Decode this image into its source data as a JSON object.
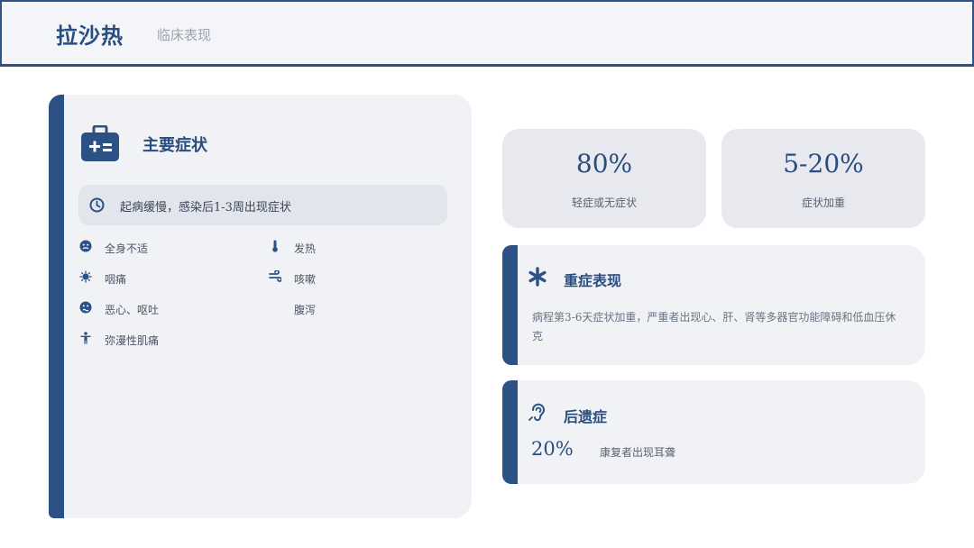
{
  "header": {
    "title": "拉沙热",
    "subtitle": "临床表现"
  },
  "main_card": {
    "title": "主要症状",
    "onset": "起病缓慢，感染后1-3周出现症状",
    "symptoms": [
      {
        "label": "全身不适",
        "icon": "sick-face-icon"
      },
      {
        "label": "发热",
        "icon": "thermometer-icon"
      },
      {
        "label": "咽痛",
        "icon": "virus-icon"
      },
      {
        "label": "咳嗽",
        "icon": "cough-icon"
      },
      {
        "label": "恶心、呕吐",
        "icon": "nausea-face-icon"
      },
      {
        "label": "腹泻",
        "icon": ""
      },
      {
        "label": "弥漫性肌痛",
        "icon": "person-icon"
      }
    ]
  },
  "stats": [
    {
      "value": "80%",
      "caption": "轻症或无症状"
    },
    {
      "value": "5-20%",
      "caption": "症状加重"
    }
  ],
  "severe": {
    "title": "重症表现",
    "icon": "asterisk-icon",
    "description": "病程第3-6天症状加重，严重者出现心、肝、肾等多器官功能障碍和低血压休克"
  },
  "sequelae": {
    "title": "后遗症",
    "icon": "ear-icon",
    "value": "20%",
    "description": "康复者出现耳聋"
  },
  "colors": {
    "accent": "#2b5185",
    "card": "#f1f2f6",
    "stat_card": "#e7e9ee",
    "onset_bar": "#e2e5ec"
  }
}
